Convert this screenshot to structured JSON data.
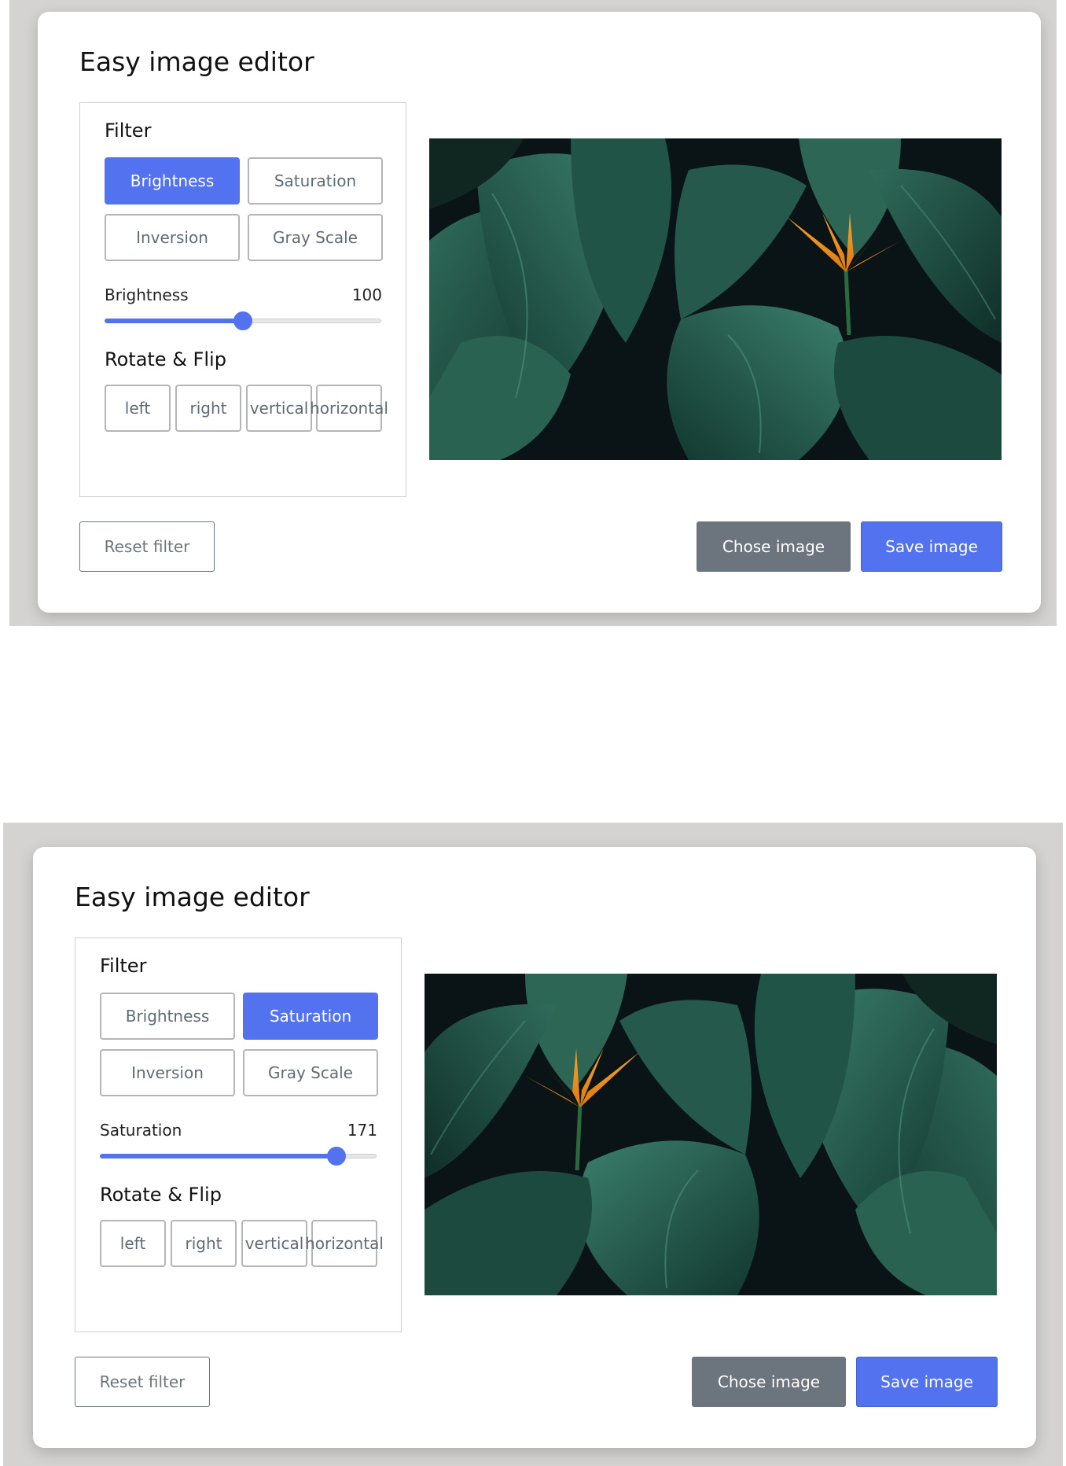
{
  "colors": {
    "accent": "#5372f0",
    "secondary": "#6c757d",
    "backdrop": "#d4d3d1"
  },
  "editors": [
    {
      "title": "Easy image editor",
      "filter": {
        "title": "Filter",
        "options": [
          "Brightness",
          "Saturation",
          "Inversion",
          "Gray Scale"
        ],
        "active": "Brightness",
        "slider_label": "Brightness",
        "slider_value": "100",
        "slider_fraction": 0.5
      },
      "rotate": {
        "title": "Rotate & Flip",
        "options": [
          "left",
          "right",
          "vertical",
          "horizontal"
        ]
      },
      "preview": {
        "description": "tropical leaves with bird of paradise flower",
        "flipped": false
      },
      "actions": {
        "reset": "Reset filter",
        "choose": "Chose image",
        "save": "Save image"
      }
    },
    {
      "title": "Easy image editor",
      "filter": {
        "title": "Filter",
        "options": [
          "Brightness",
          "Saturation",
          "Inversion",
          "Gray Scale"
        ],
        "active": "Saturation",
        "slider_label": "Saturation",
        "slider_value": "171",
        "slider_fraction": 0.855
      },
      "rotate": {
        "title": "Rotate & Flip",
        "options": [
          "left",
          "right",
          "vertical",
          "horizontal"
        ]
      },
      "preview": {
        "description": "tropical leaves with bird of paradise flower",
        "flipped": true
      },
      "actions": {
        "reset": "Reset filter",
        "choose": "Chose image",
        "save": "Save image"
      }
    }
  ]
}
